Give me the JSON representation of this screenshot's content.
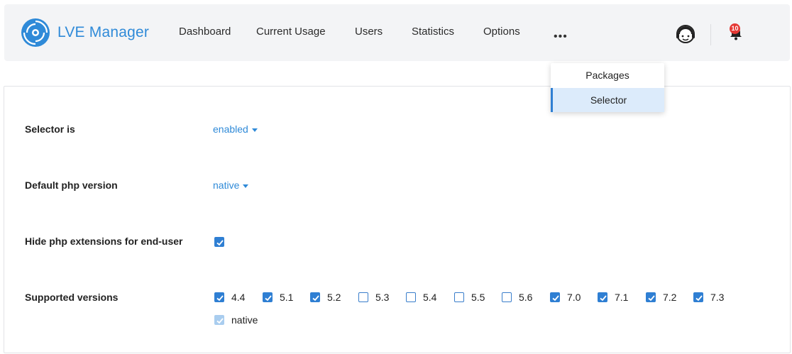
{
  "app": {
    "name": "LVE Manager",
    "accent": "#2f8ad8"
  },
  "nav": {
    "items": [
      "Dashboard",
      "Current Usage",
      "Users",
      "Statistics",
      "Options"
    ],
    "more_icon": "more-dots-icon"
  },
  "header": {
    "notification_count": "10",
    "support_icon": "support-agent-icon",
    "bell_icon": "bell-icon"
  },
  "more_menu": {
    "items": [
      "Packages",
      "Selector"
    ],
    "active": "Selector"
  },
  "settings": {
    "selector": {
      "label": "Selector is",
      "value": "enabled"
    },
    "default_php": {
      "label": "Default php version",
      "value": "native"
    },
    "hide_ext": {
      "label": "Hide php extensions for end-user",
      "checked": true
    },
    "supported": {
      "label": "Supported versions",
      "versions": [
        {
          "v": "4.4",
          "checked": true
        },
        {
          "v": "5.1",
          "checked": true
        },
        {
          "v": "5.2",
          "checked": true
        },
        {
          "v": "5.3",
          "checked": false
        },
        {
          "v": "5.4",
          "checked": false
        },
        {
          "v": "5.5",
          "checked": false
        },
        {
          "v": "5.6",
          "checked": false
        },
        {
          "v": "7.0",
          "checked": true
        },
        {
          "v": "7.1",
          "checked": true
        },
        {
          "v": "7.2",
          "checked": true
        },
        {
          "v": "7.3",
          "checked": true
        }
      ],
      "native": {
        "v": "native",
        "checked": true,
        "disabled": true
      }
    }
  }
}
